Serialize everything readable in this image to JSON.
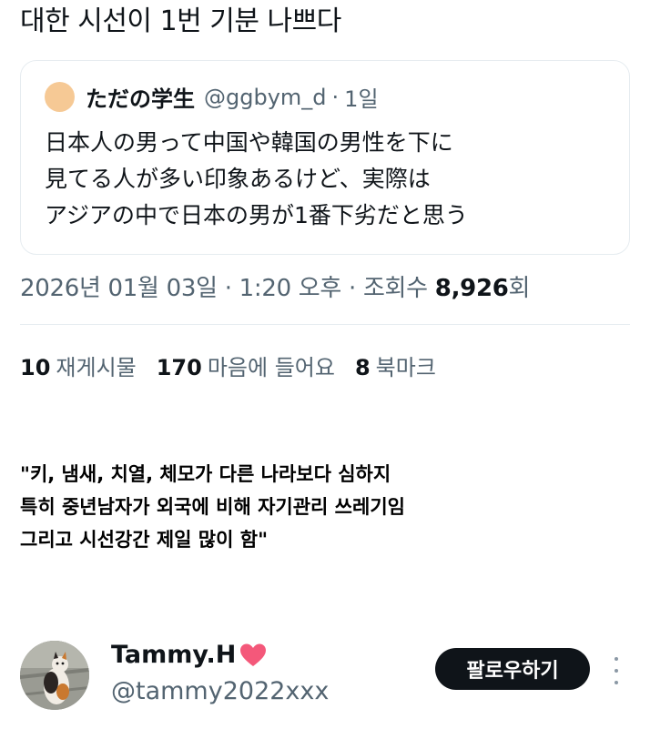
{
  "tweet": {
    "text": "대한 시선이 1번 기분 나쁘다"
  },
  "quote": {
    "name": "ただの学生",
    "handle": "@ggbym_d",
    "separator": "·",
    "time": "1일",
    "body_lines": [
      "日本人の男って中国や韓国の男性を下に",
      "見てる人が多い印象あるけど、実際は",
      "アジアの中で日本の男が1番下劣だと思う"
    ]
  },
  "meta": {
    "date": "2026년 01월 03일",
    "time": "1:20 오후",
    "views_label": "조회수",
    "views_count": "8,926",
    "views_suffix": "회"
  },
  "stats": {
    "reposts_count": "10",
    "reposts_label": "재게시물",
    "likes_count": "170",
    "likes_label": "마음에 들어요",
    "bookmarks_count": "8",
    "bookmarks_label": "북마크"
  },
  "caption": {
    "lines": [
      "\"키, 냄새, 치열, 체모가 다른 나라보다 심하지",
      "특히 중년남자가 외국에 비해 자기관리 쓰레기임",
      "그리고 시선강간 제일 많이 함\""
    ]
  },
  "user": {
    "name": "Tammy.H",
    "handle": "@tammy2022xxx",
    "follow_label": "팔로우하기"
  },
  "colors": {
    "text_primary": "#0f1419",
    "text_secondary": "#536471",
    "border": "#e6ecf0",
    "follow_button_bg": "#0f1419",
    "heart": "#f4587a",
    "quote_avatar": "#f6c995"
  },
  "icons": {
    "heart": "heart-icon",
    "more": "more-vertical-icon"
  }
}
